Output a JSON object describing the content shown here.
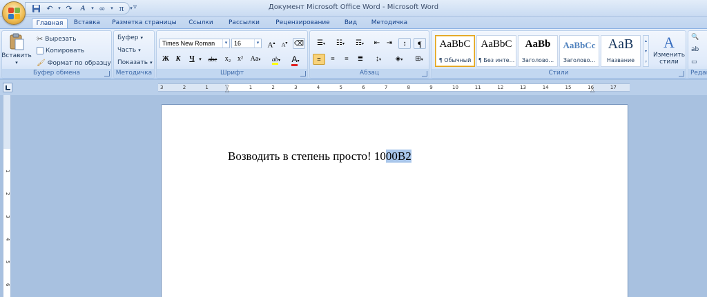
{
  "window": {
    "title": "Документ Microsoft Office Word - Microsoft Word"
  },
  "qat": {
    "save_glyph": "💾",
    "undo_glyph": "↶",
    "redo_glyph": "↷",
    "font_color_glyph": "A",
    "infinity_glyph": "∞",
    "pi_glyph": "π",
    "dropdown_glyph": "▾",
    "customize_glyph": "▿"
  },
  "tabs": [
    {
      "label": "Главная",
      "active": true
    },
    {
      "label": "Вставка"
    },
    {
      "label": "Разметка страницы"
    },
    {
      "label": "Ссылки"
    },
    {
      "label": "Рассылки"
    },
    {
      "label": "Рецензирование"
    },
    {
      "label": "Вид"
    },
    {
      "label": "Методичка"
    }
  ],
  "clipboard": {
    "paste": "Вставить",
    "cut": "Вырезать",
    "copy": "Копировать",
    "format_painter": "Формат по образцу",
    "group": "Буфер обмена"
  },
  "method": {
    "buffer": "Буфер",
    "part": "Часть",
    "show": "Показать",
    "group": "Методичка"
  },
  "font": {
    "name": "Times New Roman",
    "size": "16",
    "grow": "A",
    "shrink": "A",
    "bold": "Ж",
    "italic": "К",
    "underline": "Ч",
    "strike": "abe",
    "subscript": "x₂",
    "superscript": "x²",
    "change_case": "Aa",
    "highlight": "ab",
    "color": "A",
    "group": "Шрифт"
  },
  "paragraph": {
    "pilcrow": "¶",
    "group": "Абзац"
  },
  "styles": {
    "items": [
      {
        "sample": "AaBbC",
        "name": "¶ Обычный",
        "selected": true
      },
      {
        "sample": "AaBbC",
        "name": "¶ Без инте..."
      },
      {
        "sample": "AaBb",
        "name": "Заголово..."
      },
      {
        "sample": "AaBbCc",
        "name": "Заголово..."
      },
      {
        "sample": "AaB",
        "name": "Название"
      }
    ],
    "change_label_1": "Изменить",
    "change_label_2": "стили",
    "group": "Стили"
  },
  "editing": {
    "group": "Редак"
  },
  "ruler": {
    "h_ticks": [
      "3",
      "2",
      "1",
      "1",
      "2",
      "3",
      "4",
      "5",
      "6",
      "7",
      "8",
      "9",
      "10",
      "11",
      "12",
      "13",
      "14",
      "15",
      "16",
      "17"
    ],
    "v_ticks": [
      "1",
      "2",
      "3",
      "4",
      "5",
      "6"
    ]
  },
  "document": {
    "text_before": "Возводить в степень просто! 10",
    "text_selected": "00B2"
  },
  "colors": {
    "selection": "#a9c6ea",
    "ribbon": "#dfeafa",
    "workspace": "#a8c1e0"
  }
}
